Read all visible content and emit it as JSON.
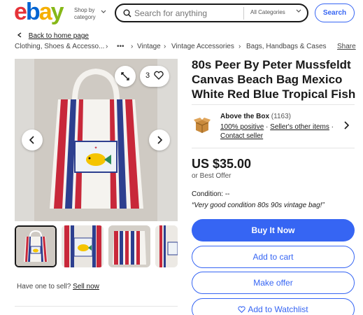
{
  "header": {
    "logo_letters": [
      "e",
      "b",
      "a",
      "y"
    ],
    "logo_colors": [
      "#e53238",
      "#0064d2",
      "#f5af02",
      "#86b817"
    ],
    "shop_by_line1": "Shop by",
    "shop_by_line2": "category",
    "search_placeholder": "Search for anything",
    "category_select": "All Categories",
    "search_button": "Search"
  },
  "breadcrumb": {
    "back_label": "Back to home page",
    "items": [
      "Clothing, Shoes & Accesso...",
      "Vintage",
      "Vintage Accessories",
      "Bags, Handbags & Cases"
    ],
    "more": "•••",
    "share": "Share"
  },
  "gallery": {
    "watch_count": "3",
    "thumbnail_count": 4,
    "selected_thumbnail": 1
  },
  "sell": {
    "prompt": "Have one to sell?",
    "link": "Sell now"
  },
  "listing": {
    "title": "80s Peer By Peter Mussfeldt Canvas Beach Bag Mexico White Red Blue Tropical Fish",
    "seller": {
      "name": "Above the Box",
      "feedback_count": "(1163)",
      "positive": "100% positive",
      "other_items": "Seller's other items",
      "contact": "Contact seller"
    },
    "price": "US $35.00",
    "best_offer": "or Best Offer",
    "condition_label": "Condition:",
    "condition_value": "--",
    "condition_note": "“Very good condition 80s 90s vintage bag!”"
  },
  "actions": {
    "buy_now": "Buy It Now",
    "add_to_cart": "Add to cart",
    "make_offer": "Make offer",
    "add_to_watchlist": "Add to Watchlist"
  },
  "colors": {
    "accent": "#3665f3",
    "bag_red": "#c8283a",
    "bag_blue": "#2d3f8f"
  }
}
